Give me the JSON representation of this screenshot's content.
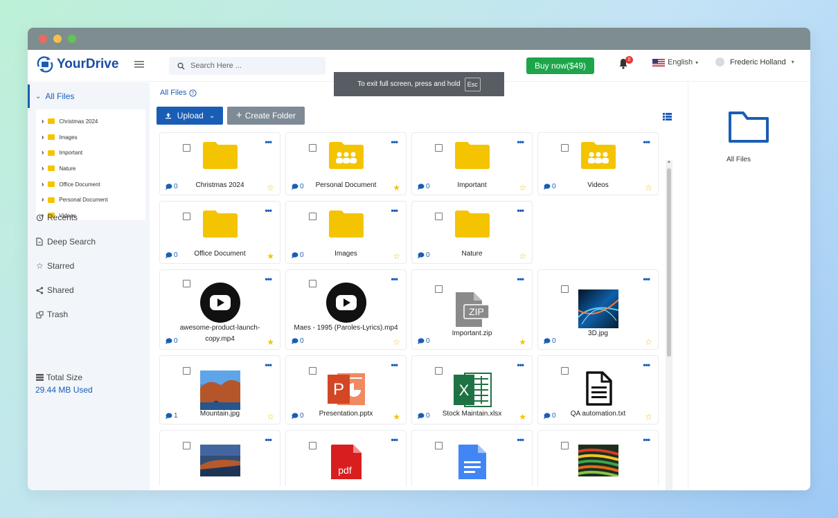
{
  "window": {
    "dots": {
      "close": "#ec6a5e",
      "minimize": "#f4bf4f",
      "maximize": "#61c554"
    }
  },
  "brand": {
    "name": "YourDrive",
    "color": "#1a4e9e"
  },
  "search": {
    "placeholder": "Search Here ..."
  },
  "header": {
    "buy_label": "Buy now($49)",
    "notification_count": "0",
    "language": "English",
    "user_name": "Frederic Holland"
  },
  "toast": {
    "message": "To exit full screen, press and hold",
    "key": "Esc"
  },
  "sidebar": {
    "all_files": "All Files",
    "tree": [
      "Christmas 2024",
      "Images",
      "Important",
      "Nature",
      "Office Document",
      "Personal Document",
      "Videos"
    ],
    "nav": [
      {
        "label": "Recents",
        "icon": "history-icon"
      },
      {
        "label": "Deep Search",
        "icon": "document-icon"
      },
      {
        "label": "Starred",
        "icon": "star-icon"
      },
      {
        "label": "Shared",
        "icon": "share-icon"
      },
      {
        "label": "Trash",
        "icon": "trash-icon"
      }
    ],
    "total_label": "Total Size",
    "total_value": "29.44 MB Used"
  },
  "main": {
    "breadcrumb": "All Files",
    "upload_label": "Upload",
    "create_label": "Create Folder",
    "items": [
      {
        "name": "Christmas 2024",
        "type": "folder",
        "comments": "0",
        "starred": false
      },
      {
        "name": "Personal Document",
        "type": "folder-shared",
        "comments": "0",
        "starred": true
      },
      {
        "name": "Important",
        "type": "folder",
        "comments": "0",
        "starred": false
      },
      {
        "name": "Videos",
        "type": "folder-shared",
        "comments": "0",
        "starred": false
      },
      {
        "name": "Office Document",
        "type": "folder",
        "comments": "0",
        "starred": true
      },
      {
        "name": "Images",
        "type": "folder",
        "comments": "0",
        "starred": false
      },
      {
        "name": "Nature",
        "type": "folder",
        "comments": "0",
        "starred": false
      },
      {
        "name": "awesome-product-launch-copy.mp4",
        "type": "video",
        "comments": "0",
        "starred": true
      },
      {
        "name": "Maes - 1995 (Paroles-Lyrics).mp4",
        "type": "video",
        "comments": "0",
        "starred": false
      },
      {
        "name": "Important.zip",
        "type": "zip",
        "comments": "0",
        "starred": true
      },
      {
        "name": "3D.jpg",
        "type": "image-3d",
        "comments": "0",
        "starred": false
      },
      {
        "name": "Mountain.jpg",
        "type": "image-mountain",
        "comments": "1",
        "starred": false
      },
      {
        "name": "Presentation.pptx",
        "type": "pptx",
        "comments": "0",
        "starred": true
      },
      {
        "name": "Stock Maintain.xlsx",
        "type": "xlsx",
        "comments": "0",
        "starred": true
      },
      {
        "name": "QA automation.txt",
        "type": "txt",
        "comments": "0",
        "starred": false
      },
      {
        "name": "",
        "type": "image-coast",
        "comments": "",
        "starred": false
      },
      {
        "name": "",
        "type": "pdf",
        "comments": "",
        "starred": false
      },
      {
        "name": "",
        "type": "gdoc",
        "comments": "",
        "starred": false
      },
      {
        "name": "",
        "type": "image-colorful",
        "comments": "",
        "starred": false
      }
    ]
  },
  "right_panel": {
    "label": "All Files"
  }
}
